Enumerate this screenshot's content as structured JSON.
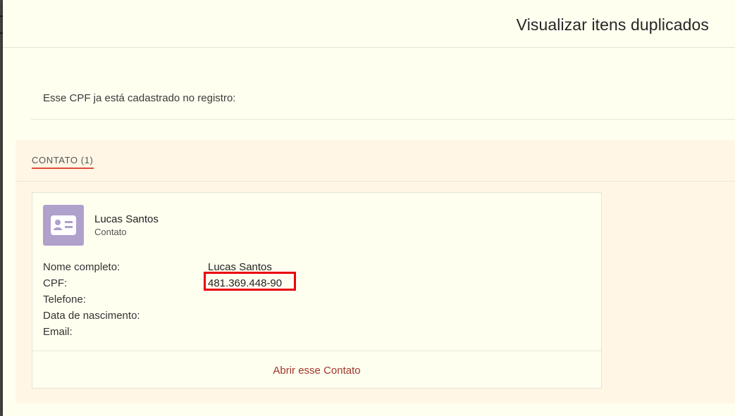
{
  "modal": {
    "title": "Visualizar itens duplicados",
    "message": "Esse CPF ja está cadastrado no registro:"
  },
  "section": {
    "tab_label": "CONTATO (1)"
  },
  "card": {
    "icon": "contact-card-icon",
    "avatar_color": "#b0a0cc",
    "name": "Lucas Santos",
    "type": "Contato",
    "fields": [
      {
        "label": "Nome completo:",
        "value": "Lucas Santos"
      },
      {
        "label": "CPF:",
        "value": "481.369.448-90"
      },
      {
        "label": "Telefone:",
        "value": ""
      },
      {
        "label": "Data de nascimento:",
        "value": ""
      },
      {
        "label": "Email:",
        "value": ""
      }
    ],
    "open_link": "Abrir esse Contato"
  },
  "colors": {
    "tab_underline": "#e24b3a",
    "highlight": "#e8000b",
    "link": "#a0352a"
  }
}
